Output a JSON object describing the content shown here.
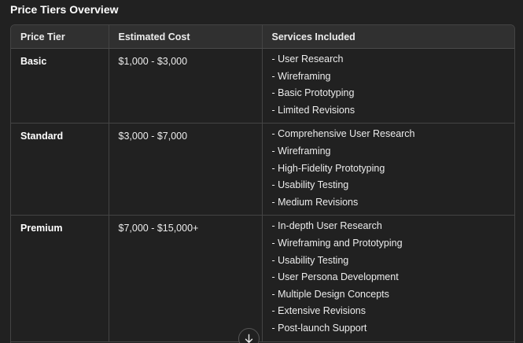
{
  "title": "Price Tiers Overview",
  "table": {
    "headers": [
      "Price Tier",
      "Estimated Cost",
      "Services Included"
    ],
    "rows": [
      {
        "tier": "Basic",
        "cost": "$1,000 - $3,000",
        "services": [
          "- User Research",
          "- Wireframing",
          "- Basic Prototyping",
          "- Limited Revisions"
        ]
      },
      {
        "tier": "Standard",
        "cost": "$3,000 - $7,000",
        "services": [
          "- Comprehensive User Research",
          "- Wireframing",
          "- High-Fidelity Prototyping",
          "- Usability Testing",
          "- Medium Revisions"
        ]
      },
      {
        "tier": "Premium",
        "cost": "$7,000 - $15,000+",
        "services": [
          "- In-depth User Research",
          "- Wireframing and Prototyping",
          "- Usability Testing",
          "- User Persona Development",
          "- Multiple Design Concepts",
          "- Extensive Revisions",
          "- Post-launch Support"
        ]
      }
    ]
  },
  "scroll_button": {
    "icon": "arrow-down-icon"
  }
}
